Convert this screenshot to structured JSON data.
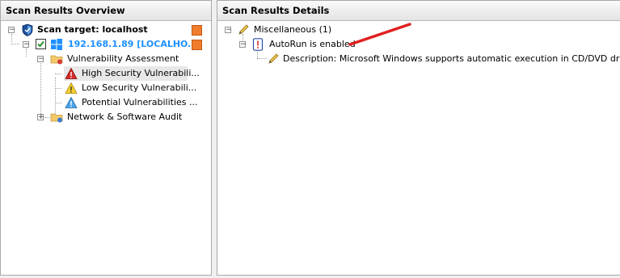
{
  "left_panel": {
    "title": "Scan Results Overview",
    "tree": {
      "target": "Scan target: localhost",
      "host": "192.168.1.89 [LOCALHO...",
      "vuln_assessment": "Vulnerability Assessment",
      "high": "High Security Vulnerabili...",
      "low": "Low Security Vulnerabili...",
      "potential": "Potential Vulnerabilities ...",
      "network_audit": "Network & Software Audit"
    }
  },
  "right_panel": {
    "title": "Scan Results Details",
    "tree": {
      "category": "Miscellaneous (1)",
      "item": "AutoRun is enabled",
      "description": "Description: Microsoft Windows supports automatic execution in CD/DVD drives and oth"
    }
  },
  "colors": {
    "host_link": "#1e90ff",
    "status_box": "#ef7d2c",
    "annotation_arrow": "#e02020"
  },
  "icons": [
    "shield-icon",
    "checkbox-checked-icon",
    "windows-logo-icon",
    "folder-icon",
    "warning-red-icon",
    "warning-yellow-icon",
    "warning-blue-icon",
    "pencil-icon",
    "alert-icon",
    "status-box-icon"
  ]
}
